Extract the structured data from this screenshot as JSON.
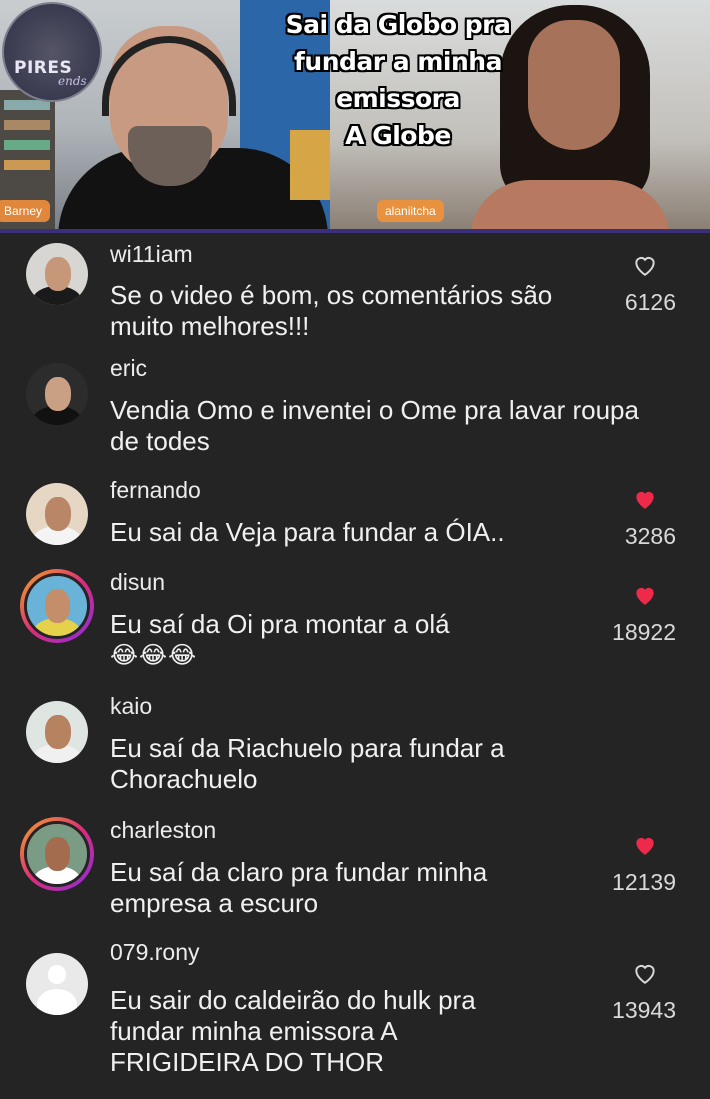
{
  "video": {
    "overlay_lines": [
      "Sai da Globo pra",
      "fundar a minha",
      "emissora",
      "A Globe"
    ],
    "logo_main": "PIRES",
    "logo_sub": "ends",
    "host_left": "Barney",
    "host_right": "alaniitcha"
  },
  "comments": [
    {
      "username": "wi11iam",
      "text": "Se o video é bom, os comentários são muito melhores!!!",
      "likes": "6126",
      "liked": false,
      "avatar": "photo"
    },
    {
      "username": "eric",
      "text": "Vendia Omo e inventei o Ome pra lavar roupa de todes",
      "likes": "",
      "liked": false,
      "avatar": "photo"
    },
    {
      "username": "fernando",
      "text": "Eu sai da Veja para fundar a ÓIA..",
      "likes": "3286",
      "liked": true,
      "avatar": "photo"
    },
    {
      "username": "disun",
      "text": "Eu saí da Oi pra montar a olá",
      "emoji": "😂😂😂",
      "likes": "18922",
      "liked": true,
      "avatar": "story"
    },
    {
      "username": "kaio",
      "text": "Eu saí da Riachuelo para fundar a Chorachuelo",
      "likes": "",
      "liked": false,
      "avatar": "photo"
    },
    {
      "username": "charleston",
      "text": "Eu saí da claro pra fundar minha empresa a escuro",
      "likes": "12139",
      "liked": true,
      "avatar": "story"
    },
    {
      "username": "079.rony",
      "text": "Eu sair do caldeirão do hulk pra fundar minha emissora A FRIGIDEIRA DO THOR",
      "likes": "13943",
      "liked": false,
      "avatar": "default"
    }
  ],
  "colors": {
    "background": "#242424",
    "like_active": "#ee2a4a",
    "like_inactive": "#d9d9d9",
    "story_ring": "#d92e7a"
  },
  "icons": [
    "heart-outline-icon",
    "heart-filled-icon",
    "default-avatar-icon"
  ]
}
